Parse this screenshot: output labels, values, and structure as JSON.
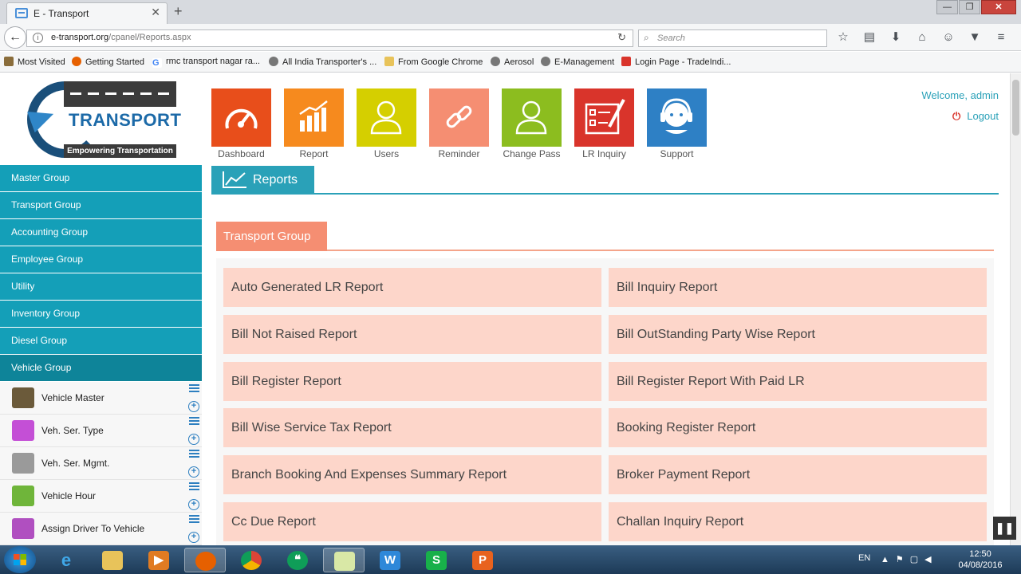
{
  "browser": {
    "tab_title": "E - Transport",
    "tab_close": "✕",
    "new_tab": "+",
    "url_domain": "e-transport.org",
    "url_path": "/cpanel/Reports.aspx",
    "search_placeholder": "Search",
    "bookmarks": [
      "Most Visited",
      "Getting Started",
      "rmc transport nagar ra...",
      "All India Transporter's ...",
      "From Google Chrome",
      "Aerosol",
      "E-Management",
      "Login Page - TradeIndi..."
    ]
  },
  "logo": {
    "word": "TRANSPORT",
    "tagline": "Empowering Transportation"
  },
  "sidebar": {
    "groups": [
      "Master Group",
      "Transport Group",
      "Accounting Group",
      "Employee Group",
      "Utility",
      "Inventory Group",
      "Diesel Group",
      "Vehicle Group"
    ],
    "sub_items": [
      "Vehicle Master",
      "Veh. Ser. Type",
      "Veh. Ser. Mgmt.",
      "Vehicle Hour",
      "Assign Driver To Vehicle"
    ],
    "add_glyph": "+"
  },
  "tiles": [
    "Dashboard",
    "Report",
    "Users",
    "Reminder",
    "Change Pass",
    "LR Inquiry",
    "Support"
  ],
  "header": {
    "welcome": "Welcome, admin",
    "logout": "Logout"
  },
  "reports_tab": "Reports",
  "transport_group_tab": "Transport Group",
  "reports": [
    "Auto Generated LR Report",
    "Bill Inquiry Report",
    "Bill Not Raised Report",
    "Bill OutStanding Party Wise Report",
    "Bill Register Report",
    "Bill Register Report With Paid LR",
    "Bill Wise Service Tax Report",
    "Booking Register Report",
    "Branch Booking And Expenses Summary Report",
    "Broker Payment Report",
    "Cc Due Report",
    "Challan Inquiry Report"
  ],
  "taskbar": {
    "lang": "EN",
    "time": "12:50",
    "date": "04/08/2016"
  },
  "colors": {
    "teal": "#149fb8",
    "salmon": "#f58e72",
    "cell": "#fdd6ca"
  }
}
